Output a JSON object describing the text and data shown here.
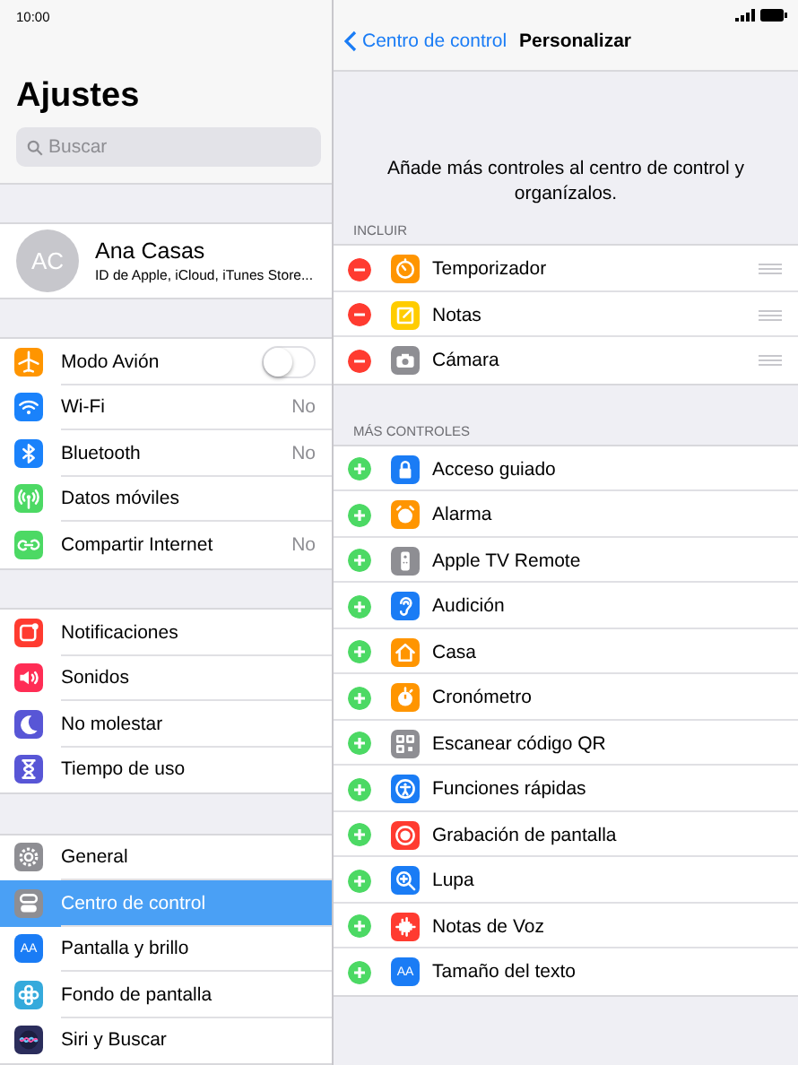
{
  "status_bar": {
    "time": "10:00"
  },
  "settings": {
    "title": "Ajustes",
    "search": {
      "placeholder": "Buscar"
    },
    "profile": {
      "initials": "AC",
      "name": "Ana Casas",
      "subtitle": "ID de Apple, iCloud, iTunes Store..."
    },
    "groups": [
      [
        {
          "label": "Modo Avión",
          "color": "#ff9500",
          "kind": "toggle",
          "on": false,
          "selected": false
        },
        {
          "label": "Wi-Fi",
          "color": "#1a82fb",
          "kind": "value",
          "value": "No",
          "selected": false
        },
        {
          "label": "Bluetooth",
          "color": "#1a82fb",
          "kind": "value",
          "value": "No",
          "selected": false
        },
        {
          "label": "Datos móviles",
          "color": "#4cd964",
          "kind": "plain",
          "selected": false
        },
        {
          "label": "Compartir Internet",
          "color": "#4cd964",
          "kind": "value",
          "value": "No",
          "selected": false
        }
      ],
      [
        {
          "label": "Notificaciones",
          "color": "#ff3b30",
          "kind": "plain",
          "selected": false
        },
        {
          "label": "Sonidos",
          "color": "#ff2d55",
          "kind": "plain",
          "selected": false
        },
        {
          "label": "No molestar",
          "color": "#5856d6",
          "kind": "plain",
          "selected": false
        },
        {
          "label": "Tiempo de uso",
          "color": "#5856d6",
          "kind": "plain",
          "selected": false
        }
      ],
      [
        {
          "label": "General",
          "color": "#8e8e93",
          "kind": "plain",
          "selected": false
        },
        {
          "label": "Centro de control",
          "color": "#8e8e93",
          "kind": "plain",
          "selected": true
        },
        {
          "label": "Pantalla y brillo",
          "color": "#1a7cf5",
          "kind": "plain",
          "icon_text": "AA",
          "selected": false
        },
        {
          "label": "Fondo de pantalla",
          "color": "#35aadc",
          "kind": "plain",
          "selected": false
        },
        {
          "label": "Siri y Buscar",
          "color": "#2b2d5c",
          "kind": "plain",
          "selected": false
        }
      ]
    ]
  },
  "detail": {
    "back": "Centro de control",
    "title": "Personalizar",
    "description": "Añade más controles al centro de control y organízalos.",
    "sections": [
      {
        "header": "INCLUIR",
        "kind": "included",
        "items": [
          {
            "label": "Temporizador",
            "color": "#ff9500"
          },
          {
            "label": "Notas",
            "color": "#ffcc00"
          },
          {
            "label": "Cámara",
            "color": "#8e8e93"
          }
        ]
      },
      {
        "header": "MÁS CONTROLES",
        "kind": "more",
        "items": [
          {
            "label": "Acceso guiado",
            "color": "#1a7cf5"
          },
          {
            "label": "Alarma",
            "color": "#ff9500"
          },
          {
            "label": "Apple TV Remote",
            "color": "#8e8e93"
          },
          {
            "label": "Audición",
            "color": "#1a7cf5"
          },
          {
            "label": "Casa",
            "color": "#ff9500"
          },
          {
            "label": "Cronómetro",
            "color": "#ff9500"
          },
          {
            "label": "Escanear código QR",
            "color": "#8e8e93"
          },
          {
            "label": "Funciones rápidas",
            "color": "#1a7cf5"
          },
          {
            "label": "Grabación de pantalla",
            "color": "#ff3b30"
          },
          {
            "label": "Lupa",
            "color": "#1a7cf5"
          },
          {
            "label": "Notas de Voz",
            "color": "#ff3b30"
          },
          {
            "label": "Tamaño del texto",
            "color": "#1a7cf5",
            "icon_text": "AA"
          }
        ]
      }
    ]
  }
}
